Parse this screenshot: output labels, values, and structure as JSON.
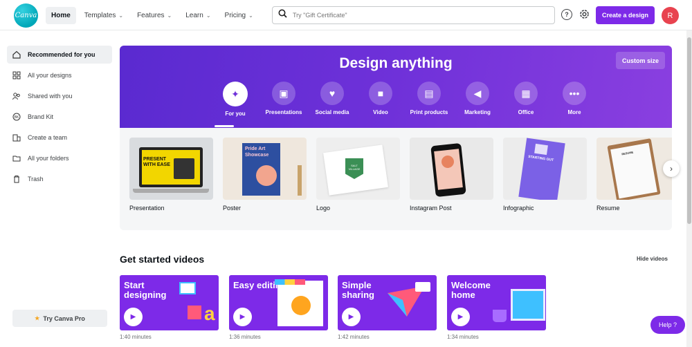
{
  "header": {
    "logo_text": "Canva",
    "nav": [
      {
        "label": "Home",
        "active": true
      },
      {
        "label": "Templates",
        "caret": true
      },
      {
        "label": "Features",
        "caret": true
      },
      {
        "label": "Learn",
        "caret": true
      },
      {
        "label": "Pricing",
        "caret": true
      }
    ],
    "search_placeholder": "Try \"Gift Certificate\"",
    "help_icon": "?",
    "create_label": "Create a design",
    "avatar_initial": "R"
  },
  "sidebar": {
    "items": [
      {
        "label": "Recommended for you",
        "icon": "home-icon",
        "active": true
      },
      {
        "label": "All your designs",
        "icon": "grid-icon"
      },
      {
        "label": "Shared with you",
        "icon": "people-icon"
      },
      {
        "label": "Brand Kit",
        "icon": "brand-kit-icon"
      },
      {
        "label": "Create a team",
        "icon": "building-icon"
      },
      {
        "label": "All your folders",
        "icon": "folder-icon"
      },
      {
        "label": "Trash",
        "icon": "trash-icon"
      }
    ],
    "pro_label": "Try Canva Pro"
  },
  "hero": {
    "title": "Design anything",
    "custom_size": "Custom size",
    "categories": [
      {
        "label": "For you",
        "icon": "sparkle-icon",
        "glyph": "✦"
      },
      {
        "label": "Presentations",
        "icon": "presentation-icon",
        "glyph": "▣"
      },
      {
        "label": "Social media",
        "icon": "heart-icon",
        "glyph": "♥"
      },
      {
        "label": "Video",
        "icon": "video-icon",
        "glyph": "■"
      },
      {
        "label": "Print products",
        "icon": "print-icon",
        "glyph": "▤"
      },
      {
        "label": "Marketing",
        "icon": "megaphone-icon",
        "glyph": "◀"
      },
      {
        "label": "Office",
        "icon": "briefcase-icon",
        "glyph": "▦"
      },
      {
        "label": "More",
        "icon": "more-icon",
        "glyph": "•••"
      }
    ]
  },
  "templates": [
    {
      "label": "Presentation",
      "thumb_text": "PRESENT WITH EASE"
    },
    {
      "label": "Poster",
      "thumb_text": "Pride Art Showcase"
    },
    {
      "label": "Logo",
      "thumb_text": "SALT VILLAGE"
    },
    {
      "label": "Instagram Post",
      "thumb_text": ""
    },
    {
      "label": "Infographic",
      "thumb_text": "STARTING OUT"
    },
    {
      "label": "Resume",
      "thumb_text": "RESUME"
    }
  ],
  "videos_section": {
    "title": "Get started videos",
    "hide_label": "Hide videos",
    "videos": [
      {
        "title": "Start designing",
        "duration": "1:40 minutes"
      },
      {
        "title": "Easy editing",
        "duration": "1:36 minutes"
      },
      {
        "title": "Simple sharing",
        "duration": "1:42 minutes"
      },
      {
        "title": "Welcome home",
        "duration": "1:34 minutes"
      }
    ]
  },
  "help_label": "Help ?",
  "colors": {
    "brand_purple": "#7d2ae8",
    "logo_teal": "#00a7b8",
    "avatar_red": "#e8434f"
  }
}
